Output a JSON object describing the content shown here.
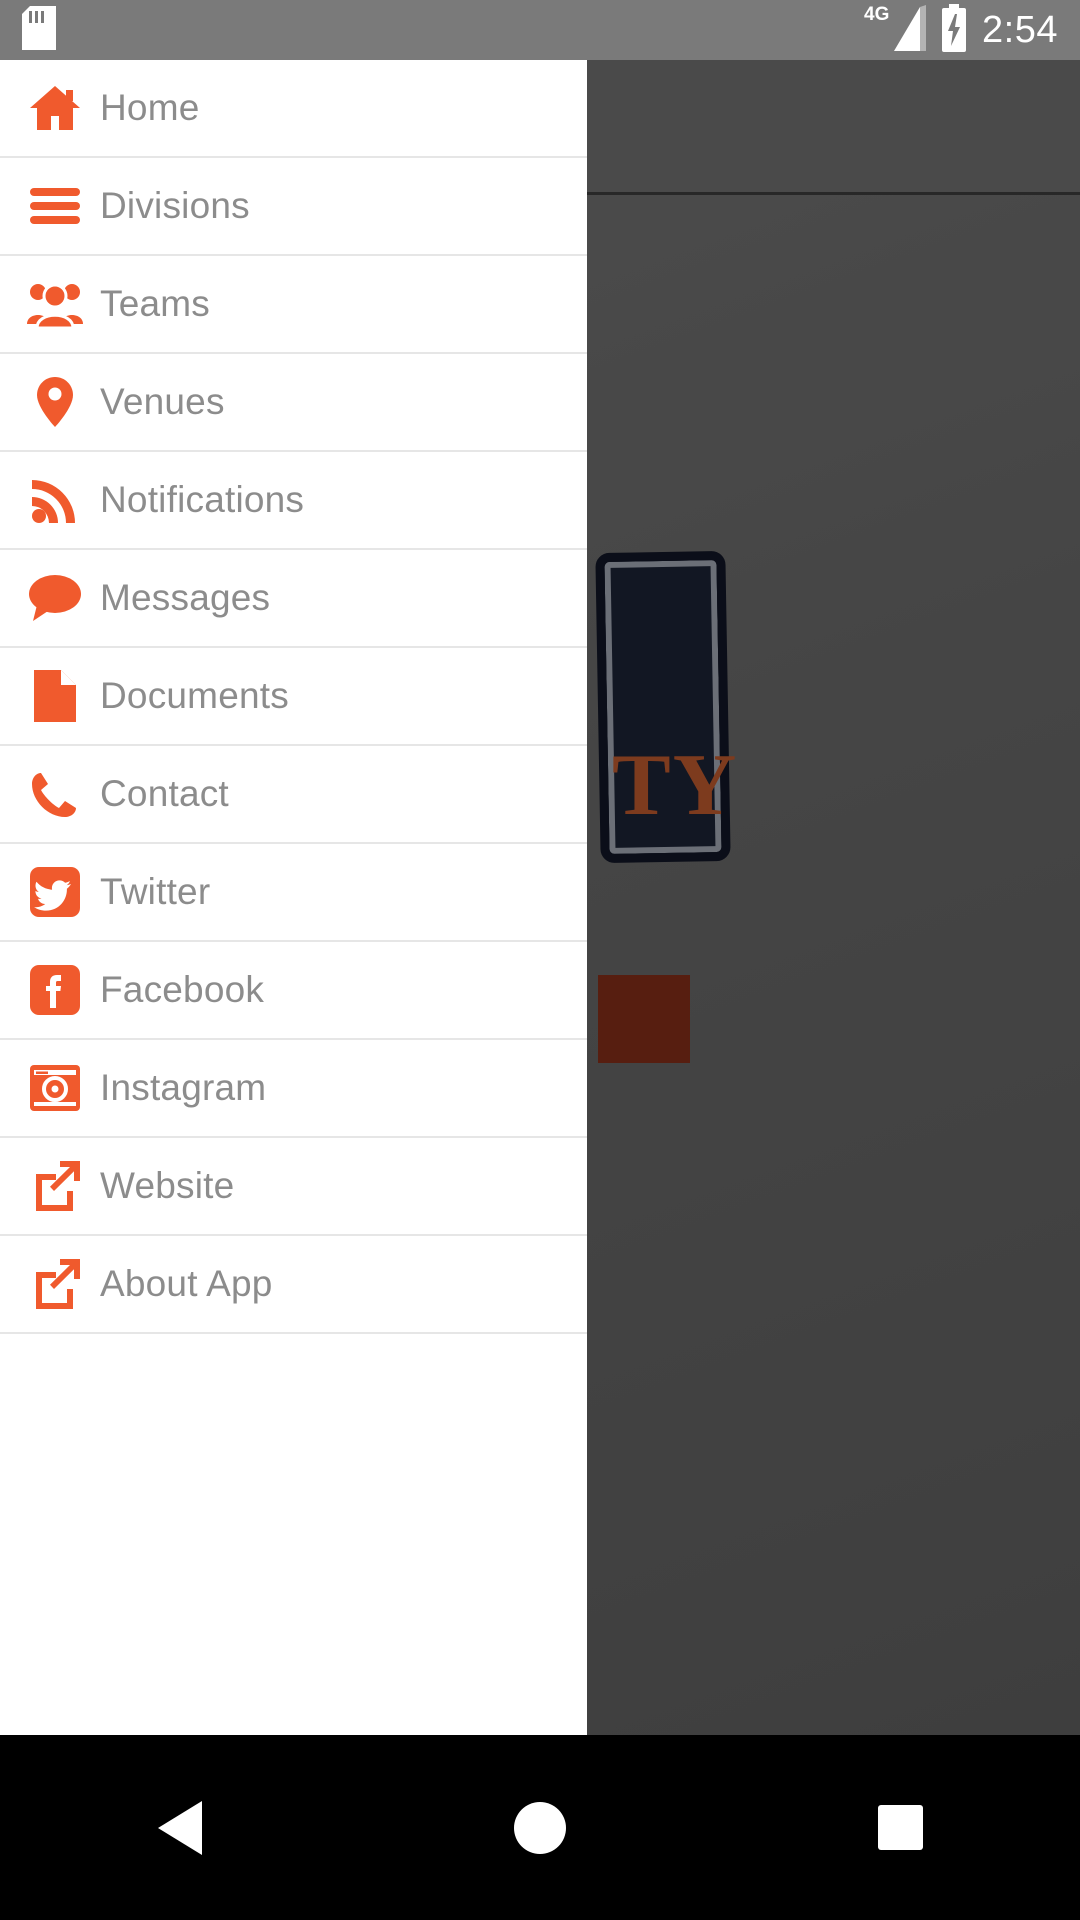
{
  "status_bar": {
    "time": "2:54",
    "network_label": "4G",
    "icons": [
      "sd-card-icon",
      "signal-4g-icon",
      "battery-charging-icon"
    ]
  },
  "drawer": {
    "items": [
      {
        "label": "Home",
        "icon": "home-icon"
      },
      {
        "label": "Divisions",
        "icon": "list-bars-icon"
      },
      {
        "label": "Teams",
        "icon": "users-group-icon"
      },
      {
        "label": "Venues",
        "icon": "map-pin-icon"
      },
      {
        "label": "Notifications",
        "icon": "rss-feed-icon"
      },
      {
        "label": "Messages",
        "icon": "chat-bubble-icon"
      },
      {
        "label": "Documents",
        "icon": "document-page-icon"
      },
      {
        "label": "Contact",
        "icon": "phone-icon"
      },
      {
        "label": "Twitter",
        "icon": "twitter-icon"
      },
      {
        "label": "Facebook",
        "icon": "facebook-icon"
      },
      {
        "label": "Instagram",
        "icon": "instagram-camera-icon"
      },
      {
        "label": "Website",
        "icon": "external-link-icon"
      },
      {
        "label": "About App",
        "icon": "external-link-icon"
      }
    ]
  },
  "background": {
    "logo_text": "TY"
  },
  "nav_bar": {
    "buttons": [
      {
        "name": "back",
        "icon": "back-triangle-icon"
      },
      {
        "name": "home",
        "icon": "home-circle-icon"
      },
      {
        "name": "recent",
        "icon": "recents-square-icon"
      }
    ]
  },
  "colors": {
    "accent": "#f05a2d",
    "label_text": "#8c8c8c",
    "status_bar": "#7a7a7a",
    "divider": "#e6e6e6"
  }
}
